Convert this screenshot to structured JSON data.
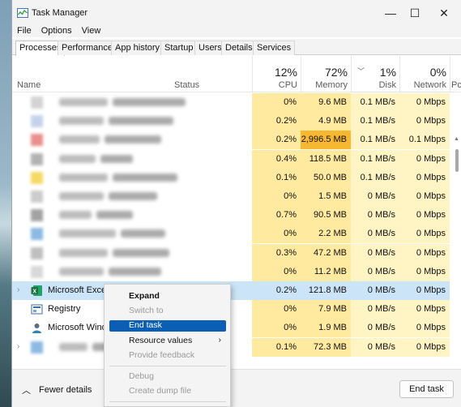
{
  "window": {
    "title": "Task Manager",
    "minimize": "—",
    "maximize": "☐",
    "close": "✕"
  },
  "menu": [
    "File",
    "Options",
    "View"
  ],
  "tabs": [
    "Processes",
    "Performance",
    "App history",
    "Startup",
    "Users",
    "Details",
    "Services"
  ],
  "header": {
    "name": "Name",
    "status": "Status",
    "cpu": {
      "pct": "12%",
      "label": "CPU"
    },
    "memory": {
      "pct": "72%",
      "label": "Memory"
    },
    "disk": {
      "pct": "1%",
      "label": "Disk"
    },
    "network": {
      "pct": "0%",
      "label": "Network"
    },
    "power": {
      "label": "Pc"
    }
  },
  "rows": [
    {
      "name": "",
      "blurred": true,
      "icon": "blurred-app-icon",
      "cpu": "0%",
      "memory": "9.6 MB",
      "disk": "0.1 MB/s",
      "network": "0 Mbps"
    },
    {
      "name": "",
      "blurred": true,
      "icon": "blurred-app-icon",
      "cpu": "0.2%",
      "memory": "4.9 MB",
      "disk": "0.1 MB/s",
      "network": "0 Mbps"
    },
    {
      "name": "",
      "blurred": true,
      "icon": "blurred-app-icon",
      "cpu": "0.2%",
      "memory": "2,996.5 MB",
      "disk": "0.1 MB/s",
      "network": "0.1 Mbps",
      "memory_highlight": "#f7b731"
    },
    {
      "name": "",
      "blurred": true,
      "icon": "blurred-app-icon",
      "cpu": "0.4%",
      "memory": "118.5 MB",
      "disk": "0.1 MB/s",
      "network": "0 Mbps"
    },
    {
      "name": "",
      "blurred": true,
      "icon": "blurred-app-icon",
      "cpu": "0.1%",
      "memory": "50.0 MB",
      "disk": "0.1 MB/s",
      "network": "0 Mbps"
    },
    {
      "name": "",
      "blurred": true,
      "icon": "blurred-app-icon",
      "cpu": "0%",
      "memory": "1.5 MB",
      "disk": "0 MB/s",
      "network": "0 Mbps"
    },
    {
      "name": "",
      "blurred": true,
      "icon": "blurred-app-icon",
      "cpu": "0.7%",
      "memory": "90.5 MB",
      "disk": "0 MB/s",
      "network": "0 Mbps"
    },
    {
      "name": "",
      "blurred": true,
      "icon": "blurred-app-icon",
      "cpu": "0%",
      "memory": "2.2 MB",
      "disk": "0 MB/s",
      "network": "0 Mbps"
    },
    {
      "name": "",
      "blurred": true,
      "icon": "blurred-app-icon",
      "cpu": "0.3%",
      "memory": "47.2 MB",
      "disk": "0 MB/s",
      "network": "0 Mbps"
    },
    {
      "name": "",
      "blurred": true,
      "icon": "blurred-app-icon",
      "cpu": "0%",
      "memory": "11.2 MB",
      "disk": "0 MB/s",
      "network": "0 Mbps"
    },
    {
      "name": "Microsoft Excel",
      "blurred": false,
      "icon": "excel-icon",
      "cpu": "0.2%",
      "memory": "121.8 MB",
      "disk": "0 MB/s",
      "network": "0 Mbps",
      "selected": true,
      "expandable": true
    },
    {
      "name": "Registry",
      "blurred": false,
      "icon": "registry-icon",
      "cpu": "0%",
      "memory": "7.9 MB",
      "disk": "0 MB/s",
      "network": "0 Mbps"
    },
    {
      "name": "Microsoft Windo",
      "blurred": false,
      "icon": "user-icon",
      "cpu": "0%",
      "memory": "1.9 MB",
      "disk": "0 MB/s",
      "network": "0 Mbps"
    },
    {
      "name": "",
      "blurred": true,
      "icon": "blurred-app-icon",
      "cpu": "0.1%",
      "memory": "72.3 MB",
      "disk": "0 MB/s",
      "network": "0 Mbps",
      "expandable": true
    }
  ],
  "context_menu": {
    "items": [
      {
        "label": "Expand",
        "bold": true,
        "disabled": false
      },
      {
        "label": "Switch to",
        "disabled": true
      },
      {
        "label": "End task",
        "hover": true
      },
      {
        "label": "Resource values",
        "submenu": true
      },
      {
        "label": "Provide feedback",
        "disabled": true
      },
      {
        "label": "Debug",
        "disabled": true
      },
      {
        "label": "Create dump file",
        "disabled": true
      }
    ]
  },
  "footer": {
    "fewer_details": "Fewer details",
    "end_task": "End task"
  },
  "colors": {
    "accent": "#0a5fb4",
    "selection": "#cce4f7",
    "heat_low": "#fff4c4",
    "heat_mid": "#ffeaa0",
    "heat_high": "#f7b731",
    "excel_green": "#1d6f42"
  }
}
